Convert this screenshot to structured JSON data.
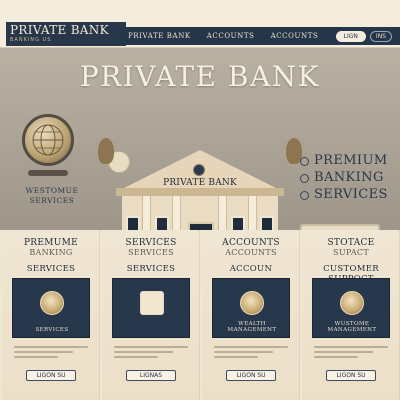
{
  "header": {
    "brand_name": "PRIVATE BANK",
    "brand_subtitle": "BANKING US",
    "nav": [
      "PRIVATE BANK",
      "ACCOUNTS",
      "ACCOUNTS"
    ],
    "login_label": "LIGN",
    "search_label": "INS"
  },
  "hero": {
    "title": "PRIVATE BANK",
    "building_sign": "PRIVATE BANK",
    "welcome_line1": "WESTOMUE",
    "welcome_line2": "SERVICES",
    "features": [
      "PREMIUM",
      "BANKING",
      "SERVICES"
    ]
  },
  "cards": [
    {
      "top": "PREMUME",
      "top2": "BANKING",
      "heading": "SERVICES",
      "panel_label": "SERVICES",
      "icon": "safe-dial-icon",
      "button": "LIGON SU"
    },
    {
      "top": "SERVICES",
      "top2": "SERVICES",
      "heading": "SERVICES",
      "panel_label": "",
      "icon": "dollar-document-icon",
      "button": "LIGNAS"
    },
    {
      "top": "ACCOUNTS",
      "top2": "ACCOUNTS",
      "heading": "ACCOUN",
      "panel_label": "WEALTH MANAGEMENT",
      "icon": "coin-icon",
      "button": "LIGON SU"
    },
    {
      "top": "STOTACE",
      "top2": "SUPACT",
      "heading": "CUSTOMER SUPPOCT",
      "panel_label": "WUSTOME MANAGEMENT",
      "icon": "compass-icon",
      "button": "LIGON SU"
    }
  ],
  "colors": {
    "navy": "#26364a",
    "cream": "#efe6d4",
    "gold": "#c7a870"
  }
}
